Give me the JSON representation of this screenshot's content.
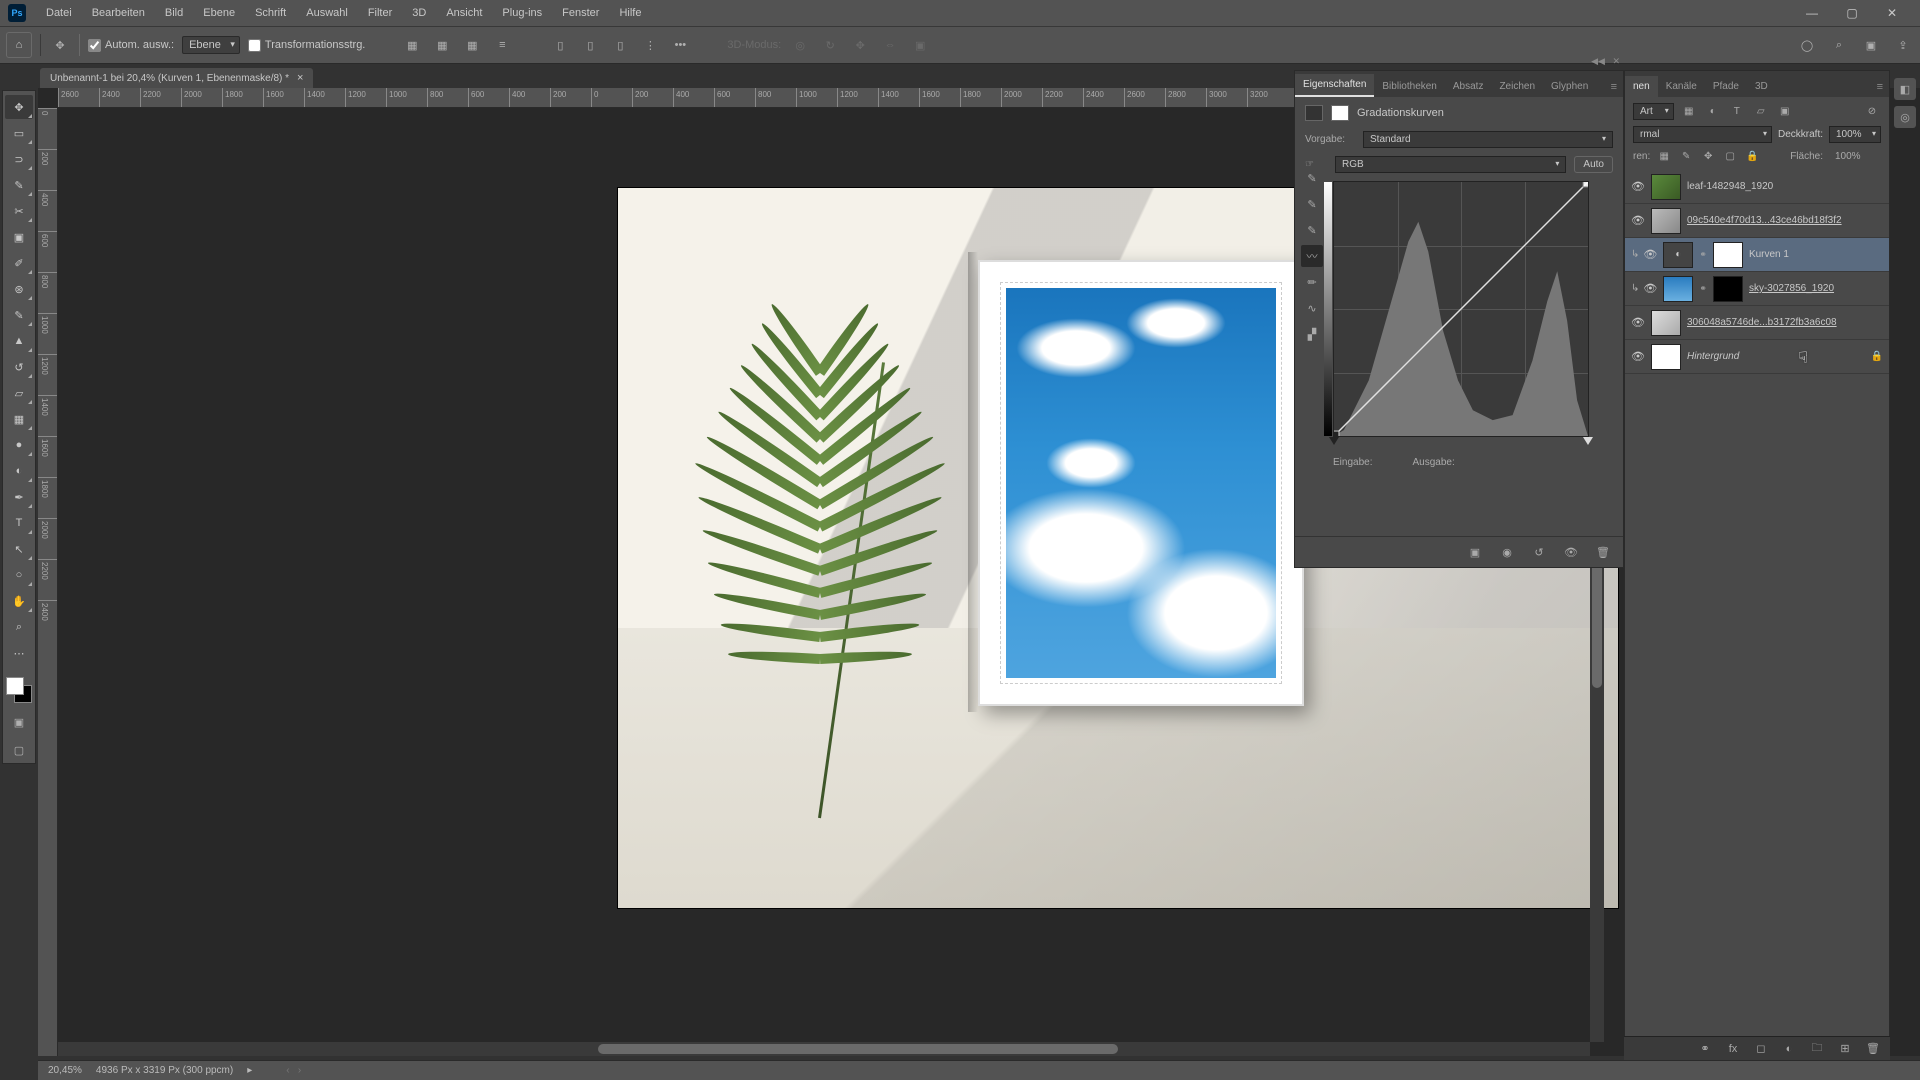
{
  "menu": {
    "items": [
      "Datei",
      "Bearbeiten",
      "Bild",
      "Ebene",
      "Schrift",
      "Auswahl",
      "Filter",
      "3D",
      "Ansicht",
      "Plug-ins",
      "Fenster",
      "Hilfe"
    ]
  },
  "optbar": {
    "auto_select_label": "Autom. ausw.:",
    "auto_select_target": "Ebene",
    "show_transform": "Transformationsstrg.",
    "mode3d": "3D-Modus:"
  },
  "doc_tab": "Unbenannt-1 bei 20,4% (Kurven 1, Ebenenmaske/8) *",
  "ruler_marks": [
    "2600",
    "2400",
    "2200",
    "2000",
    "1800",
    "1600",
    "1400",
    "1200",
    "1000",
    "800",
    "600",
    "400",
    "200",
    "0",
    "200",
    "400",
    "600",
    "800",
    "1000",
    "1200",
    "1400",
    "1600",
    "1800",
    "2000",
    "2200",
    "2400",
    "2600",
    "2800",
    "3000",
    "3200"
  ],
  "ruler_v_marks": [
    "0",
    "200",
    "400",
    "600",
    "800",
    "1000",
    "1200",
    "1400",
    "1600",
    "1800",
    "2000",
    "2200",
    "2400"
  ],
  "props": {
    "tabs": [
      "Eigenschaften",
      "Bibliotheken",
      "Absatz",
      "Zeichen",
      "Glyphen"
    ],
    "title": "Gradationskurven",
    "preset_label": "Vorgabe:",
    "preset_value": "Standard",
    "channel_value": "RGB",
    "auto": "Auto",
    "input_label": "Eingabe:",
    "output_label": "Ausgabe:"
  },
  "layers_panel": {
    "tabs": [
      "nen",
      "Kanäle",
      "Pfade",
      "3D"
    ],
    "filter_kind": "Art",
    "blend_mode": "rmal",
    "opacity_label": "Deckkraft:",
    "opacity_value": "100%",
    "lock_label": "ren:",
    "fill_label": "Fläche:",
    "fill_value": "100%",
    "layers": [
      {
        "name": "leaf-1482948_1920",
        "so": false,
        "mask": false,
        "clip": false
      },
      {
        "name": "09c540e4f70d13...43ce46bd18f3f2",
        "so": true,
        "mask": false,
        "clip": false
      },
      {
        "name": "Kurven 1",
        "so": false,
        "mask": true,
        "clip": true,
        "sel": true,
        "adj": true
      },
      {
        "name": "sky-3027856_1920",
        "so": true,
        "mask": true,
        "clip": true,
        "blackmask": true
      },
      {
        "name": "306048a5746de...b3172fb3a6c08",
        "so": true,
        "mask": false,
        "clip": false
      },
      {
        "name": "Hintergrund",
        "so": false,
        "mask": false,
        "clip": false,
        "italic": true,
        "locked": true
      }
    ]
  },
  "status": {
    "zoom": "20,45%",
    "docinfo": "4936 Px x 3319 Px (300 ppcm)"
  }
}
